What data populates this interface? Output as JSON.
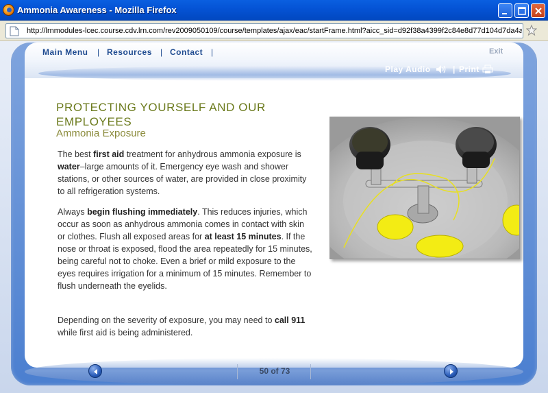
{
  "window": {
    "title": "Ammonia Awareness - Mozilla Firefox",
    "url": "http://lrnmodules-lcec.course.cdv.lrn.com/rev2009050109/course/templates/ajax/eac/startFrame.html?aicc_sid=d92f38a4399f2c84e8d77d104d7da4a"
  },
  "topnav": {
    "main_menu": "Main Menu",
    "resources": "Resources",
    "contact": "Contact",
    "separator": "|",
    "exit": "Exit",
    "play_audio": "Play Audio",
    "print": "Print"
  },
  "content": {
    "heading": "PROTECTING YOURSELF AND OUR EMPLOYEES",
    "subheading": "Ammonia Exposure",
    "p1": [
      {
        "t": "The best "
      },
      {
        "b": "first aid"
      },
      {
        "t": " treatment for anhydrous ammonia exposure is "
      },
      {
        "b": "water"
      },
      {
        "t": "–large amounts of it. Emergency eye wash and shower stations, or other sources of water, are provided in close proximity to all refrigeration systems."
      }
    ],
    "p2": [
      {
        "t": "Always "
      },
      {
        "b": "begin flushing immediately"
      },
      {
        "t": ". This reduces injuries, which occur as soon as anhydrous ammonia comes in contact with skin or clothes. Flush all exposed areas for "
      },
      {
        "b": "at least 15 minutes"
      },
      {
        "t": ". If the nose or throat is exposed, flood the area repeatedly for 15 minutes, being careful not to choke. Even a brief or mild exposure to the eyes requires irrigation for a minimum of 15 minutes. Remember to flush underneath the eyelids."
      }
    ],
    "p3": [
      {
        "t": "Depending on the severity of exposure, you may need to "
      },
      {
        "b": "call 911"
      },
      {
        "t": " while first aid is being administered."
      }
    ]
  },
  "pager": {
    "counter": "50 of 73"
  },
  "colors": {
    "heading": "#6b7a1c",
    "nav": "#1f4b90",
    "titlebar": "#0554d6"
  },
  "icons": {
    "audio": "speaker-icon",
    "print": "printer-icon",
    "prev": "arrow-left-icon",
    "next": "arrow-right-icon"
  }
}
